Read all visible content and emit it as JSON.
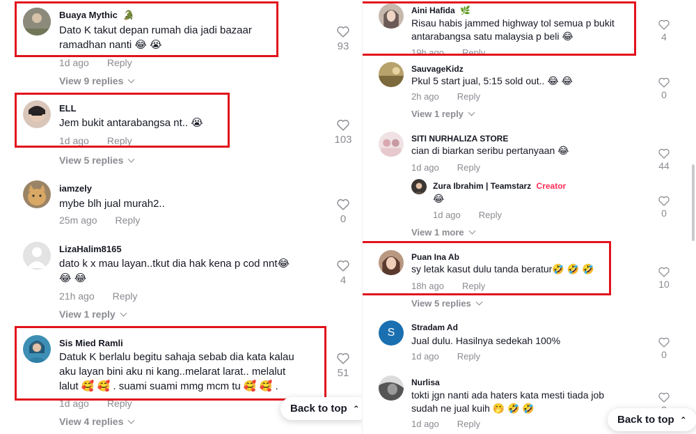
{
  "left": {
    "comments": [
      {
        "username": "Buaya Mythic",
        "badge": "🐊",
        "text": "Dato K takut depan rumah dia jadi bazaar\nramadhan nanti 😂 😭",
        "time": "1d ago",
        "reply_label": "Reply",
        "likes": "93",
        "view_replies": "View 9 replies"
      },
      {
        "username": "ELL",
        "text": "Jem bukit antarabangsa nt.. 😭",
        "time": "1d ago",
        "reply_label": "Reply",
        "likes": "103",
        "view_replies": "View 5 replies"
      },
      {
        "username": "iamzely",
        "text": "mybe blh jual murah2..",
        "time": "25m ago",
        "reply_label": "Reply",
        "likes": "0"
      },
      {
        "username": "LizaHalim8165",
        "text": "dato k x mau layan..tkut dia hak kena p cod nnt😂\n😂 😂",
        "time": "21h ago",
        "reply_label": "Reply",
        "likes": "4",
        "view_replies": "View 1 reply"
      },
      {
        "username": "Sis Mied Ramli",
        "text": "Datuk K berlalu begitu sahaja sebab dia kata kalau\naku layan bini aku ni kang..melarat larat.. melalut\nlalut 🥰 🥰 . suami suami mmg mcm tu 🥰 🥰 .",
        "time": "1d ago",
        "reply_label": "Reply",
        "likes": "51",
        "view_replies": "View 4 replies"
      }
    ],
    "back_to_top": "Back to top"
  },
  "right": {
    "comments": [
      {
        "username": "Aini Hafida",
        "badge": "🌿",
        "text": "Risau habis jammed highway tol semua p bukit\nantarabangsa satu malaysia p beli 😂",
        "time": "19h ago",
        "reply_label": "Reply",
        "likes": "4"
      },
      {
        "username": "SauvageKidz",
        "text": "Pkul 5 start jual, 5:15 sold out.. 😂 😂",
        "time": "2h ago",
        "reply_label": "Reply",
        "likes": "0",
        "view_replies": "View 1 reply"
      },
      {
        "username": "SITI NURHALIZA STORE",
        "text": "cian di biarkan seribu pertanyaan 😂",
        "time": "1d ago",
        "reply_label": "Reply",
        "likes": "44"
      },
      {
        "username": "Zura Ibrahim | Teamstarz",
        "creator_label": "Creator",
        "text": "😂",
        "time": "1d ago",
        "reply_label": "Reply",
        "likes": "0",
        "view_replies": "View 1 more"
      },
      {
        "username": "Puan Ina Ab",
        "text": "sy letak kasut dulu tanda beratur🤣 🤣 🤣",
        "time": "18h ago",
        "reply_label": "Reply",
        "likes": "10",
        "view_replies": "View 5 replies"
      },
      {
        "username": "Stradam Ad",
        "avatar_letter": "S",
        "text": "Jual dulu. Hasilnya sedekah 100%",
        "time": "1d ago",
        "reply_label": "Reply",
        "likes": "0"
      },
      {
        "username": "Nurlisa",
        "text": "tokti jgn nanti ada haters kata mesti tiada job\nsudah ne jual kuih 🤭 🤣 🤣",
        "time": "1d ago",
        "reply_label": "Reply",
        "likes": "0"
      }
    ],
    "back_to_top": "Back to top"
  },
  "colors": {
    "highlight": "#e1121c",
    "creator": "#fe2c55",
    "muted": "#8a8b91",
    "text": "#161823"
  },
  "icons": {
    "like": "heart-outline-icon",
    "back_to_top": "double-chevron-up-icon",
    "replies": "chevron-down-icon"
  }
}
